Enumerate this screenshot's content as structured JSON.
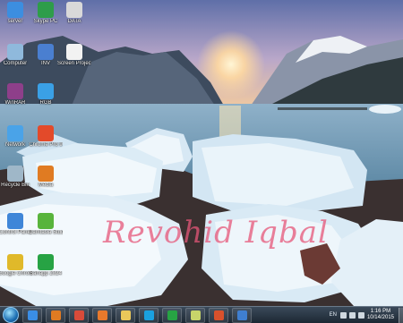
{
  "desktop_icons": [
    {
      "label": "server",
      "icon": "server-shortcut-icon",
      "color": "#3c8ee0"
    },
    {
      "label": "Skype PC",
      "icon": "skype-app-icon",
      "color": "#2e9d4a"
    },
    {
      "label": "DATA",
      "icon": "folder-icon",
      "color": "#d9d9d9"
    },
    {
      "label": "Computer",
      "icon": "computer-icon",
      "color": "#8fb9dc"
    },
    {
      "label": "INV",
      "icon": "document-icon",
      "color": "#4a7fd0"
    },
    {
      "label": "Screen Project",
      "icon": "text-file-icon",
      "color": "#f2f2f2"
    },
    {
      "label": "WinRAR",
      "icon": "winrar-icon",
      "color": "#8e3f8a"
    },
    {
      "label": "RGB",
      "icon": "rgb-app-icon",
      "color": "#3aa0e6"
    },
    {
      "label": "Network",
      "icon": "network-icon",
      "color": "#4aa3e8"
    },
    {
      "label": "Chrome Pro 9",
      "icon": "balloon-app-icon",
      "color": "#e34a2a"
    },
    {
      "label": "Recycle Bin",
      "icon": "recycle-bin-icon",
      "color": "#9fb7c8"
    },
    {
      "label": "Media",
      "icon": "media-player-icon",
      "color": "#e07b22"
    },
    {
      "label": "Control Panel",
      "icon": "control-panel-icon",
      "color": "#3f86d8"
    },
    {
      "label": "Camtasia Studio 7",
      "icon": "camtasia-icon",
      "color": "#58b43c"
    },
    {
      "label": "Google Chrome",
      "icon": "chrome-icon",
      "color": "#e0b92a"
    },
    {
      "label": "Sahapp 2024",
      "icon": "sahapp-icon",
      "color": "#27a344"
    }
  ],
  "watermark": "Revohid Iqbal",
  "taskbar": {
    "start_icon": "windows-start-icon",
    "pinned": [
      {
        "name": "ie-icon",
        "color": "#3a8ee6"
      },
      {
        "name": "media-player-icon",
        "color": "#e07b22"
      },
      {
        "name": "chrome-icon",
        "color": "#d84b3a"
      },
      {
        "name": "firefox-icon",
        "color": "#e8792c"
      },
      {
        "name": "file-explorer-icon",
        "color": "#e9c75a"
      },
      {
        "name": "skype-icon",
        "color": "#1aa1e0"
      },
      {
        "name": "sahapp-icon",
        "color": "#27a344"
      },
      {
        "name": "notepad-icon",
        "color": "#c7d46a"
      },
      {
        "name": "powerpoint-icon",
        "color": "#d9512c"
      },
      {
        "name": "browser-icon",
        "color": "#3f7fd0"
      }
    ],
    "language": "EN",
    "time": "1:16 PM",
    "date": "10/14/2015"
  }
}
